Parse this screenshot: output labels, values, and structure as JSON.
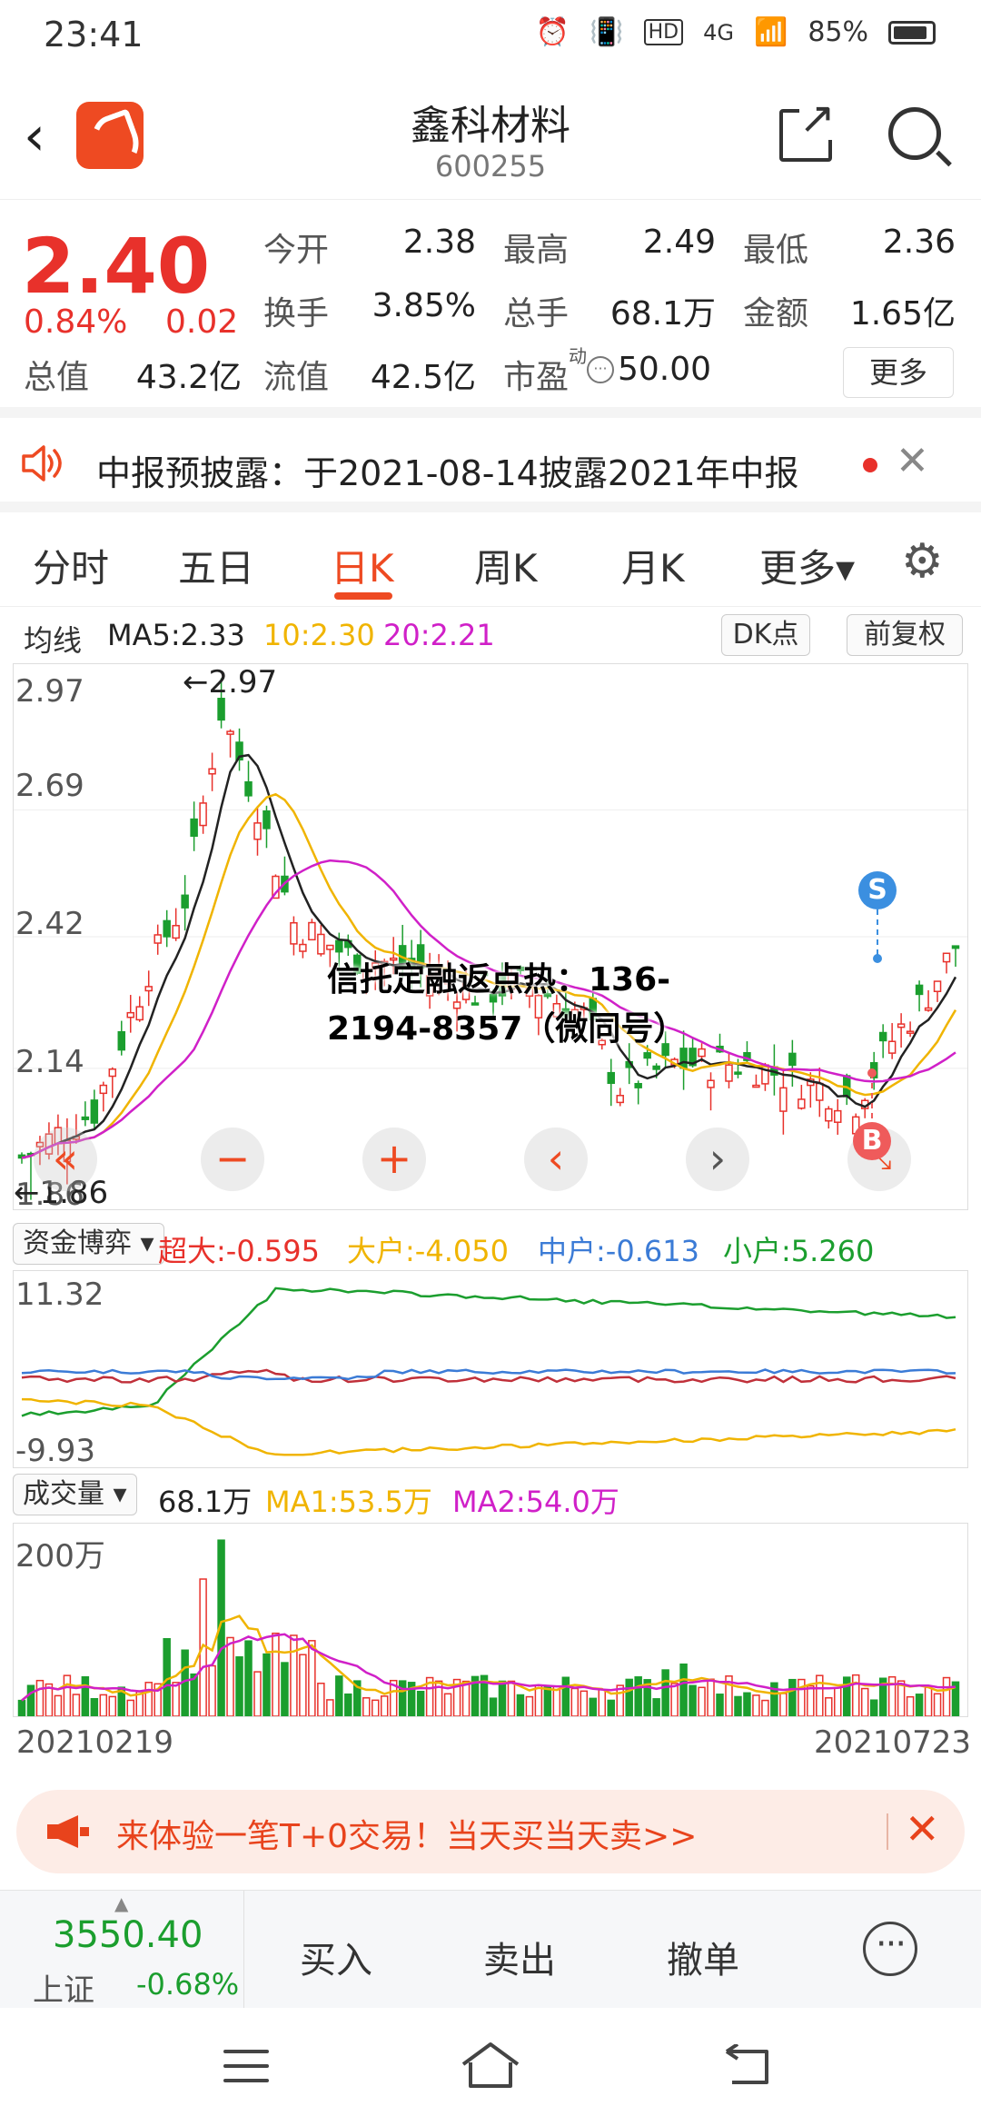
{
  "status": {
    "time": "23:41",
    "battery": "85%",
    "net": "4G",
    "hd": "HD"
  },
  "header": {
    "name": "鑫科材料",
    "code": "600255"
  },
  "quote": {
    "price": "2.40",
    "pct": "0.84%",
    "chg": "0.02",
    "stats": [
      {
        "label": "今开",
        "value": "2.38"
      },
      {
        "label": "最高",
        "value": "2.49"
      },
      {
        "label": "最低",
        "value": "2.36"
      },
      {
        "label": "换手",
        "value": "3.85%"
      },
      {
        "label": "总手",
        "value": "68.1万"
      },
      {
        "label": "金额",
        "value": "1.65亿"
      },
      {
        "label": "总值",
        "value": "43.2亿"
      },
      {
        "label": "流值",
        "value": "42.5亿"
      },
      {
        "label": "市盈",
        "value": "50.00"
      }
    ],
    "pe_sup": "动",
    "more": "更多"
  },
  "notice": {
    "text": "中报预披露：于2021-08-14披露2021年中报"
  },
  "tabs": [
    "分时",
    "五日",
    "日K",
    "周K",
    "月K",
    "更多▾"
  ],
  "ma_legend": {
    "label": "均线",
    "ma5": "MA5:2.33",
    "ma10": "10:2.30",
    "ma20": "20:2.21",
    "dk": "DK点",
    "fq": "前复权"
  },
  "kline": {
    "axis": [
      "2.97",
      "2.69",
      "2.42",
      "2.14",
      "1.86"
    ],
    "high_mark": "←2.97",
    "low_mark": "←1.86",
    "sig_s": "S",
    "sig_b": "B"
  },
  "watermark": "信托定融返点热：136-2194-8357（微同号）",
  "fund": {
    "select": "资金博弈",
    "super": "超大:-0.595",
    "big": "大户:-4.050",
    "mid": "中户:-0.613",
    "small": "小户:5.260",
    "axis_top": "11.32",
    "axis_bottom": "-9.93"
  },
  "volume": {
    "select": "成交量",
    "value": "68.1万",
    "ma1": "MA1:53.5万",
    "ma2": "MA2:54.0万",
    "axis_top": "200万",
    "date_start": "20210219",
    "date_end": "20210723"
  },
  "ad": {
    "text": "来体验一笔T+0交易！当天买当天卖>>"
  },
  "trade": {
    "index_value": "3550.40",
    "index_name": "上证",
    "index_chg": "-0.68%",
    "buy": "买入",
    "sell": "卖出",
    "cancel": "撤单"
  },
  "colors": {
    "up": "#e8312b",
    "down": "#1b9e2e",
    "ma5": "#222222",
    "ma10": "#f0b400",
    "ma20": "#d020c8",
    "accent": "#ee4a22"
  }
}
